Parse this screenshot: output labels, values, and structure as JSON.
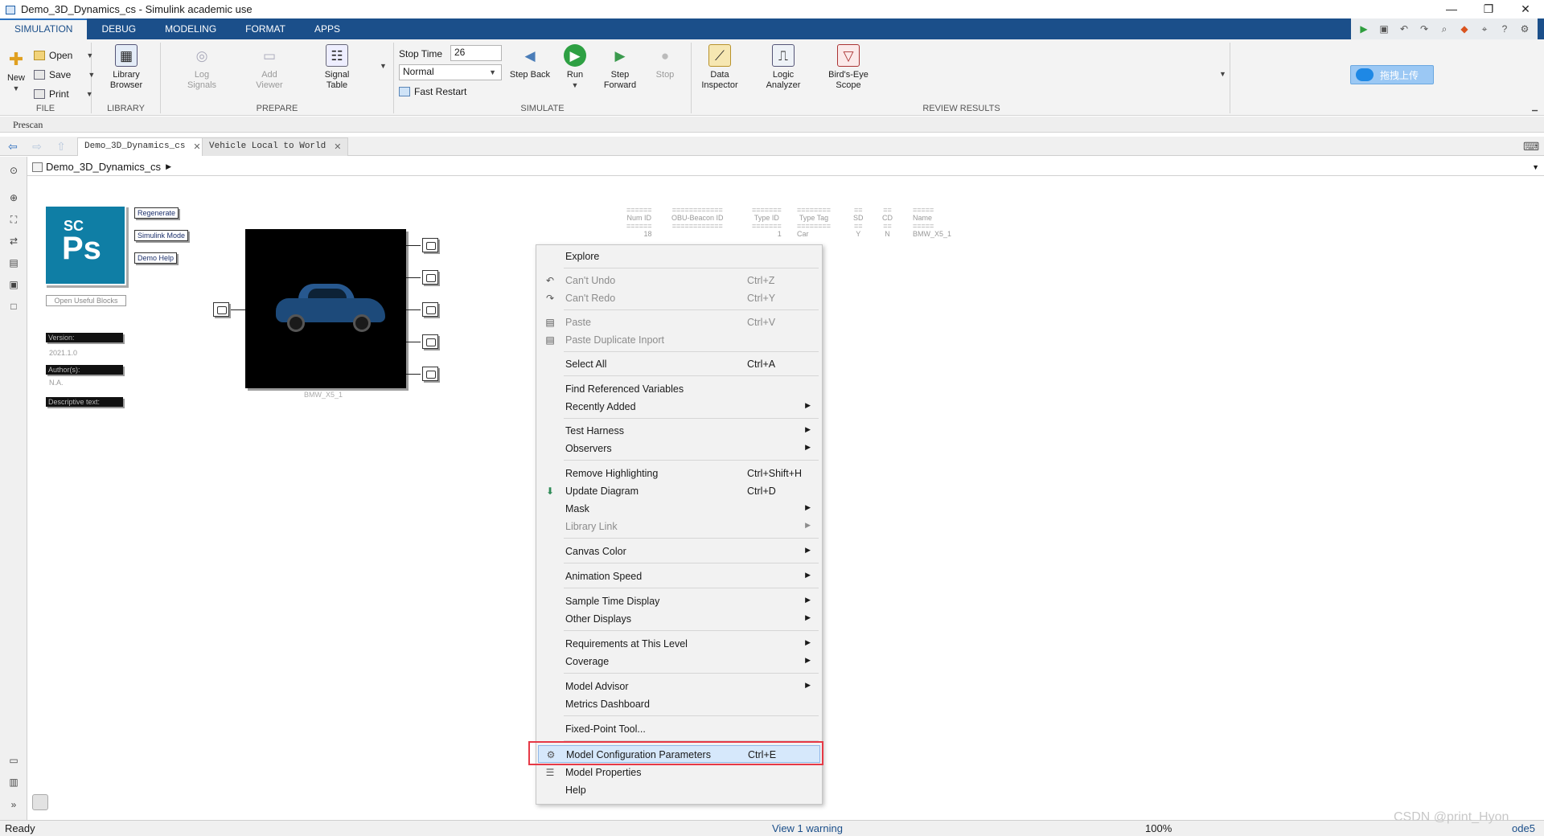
{
  "window": {
    "title": "Demo_3D_Dynamics_cs - Simulink academic use",
    "minimize": "—",
    "restore": "❐",
    "close": "✕"
  },
  "ribbon_tabs": [
    "SIMULATION",
    "DEBUG",
    "MODELING",
    "FORMAT",
    "APPS"
  ],
  "file_group": {
    "label": "FILE",
    "new_label": "New",
    "open_label": "Open",
    "save_label": "Save",
    "print_label": "Print"
  },
  "library_group": {
    "label": "LIBRARY",
    "library_browser": "Library Browser"
  },
  "prepare_group": {
    "label": "PREPARE",
    "log_signals": "Log Signals",
    "add_viewer": "Add Viewer",
    "signal_table": "Signal Table"
  },
  "simulate_group": {
    "label": "SIMULATE",
    "stop_time_label": "Stop Time",
    "stop_time_value": "26",
    "mode_value": "Normal",
    "fast_restart": "Fast Restart",
    "step_back": "Step Back",
    "run": "Run",
    "step_forward": "Step Forward",
    "stop": "Stop"
  },
  "review_group": {
    "label": "REVIEW RESULTS",
    "data_inspector": "Data Inspector",
    "logic_analyzer": "Logic Analyzer",
    "birds_eye_scope": "Bird's-Eye Scope"
  },
  "upload_button": "拖拽上传",
  "prescan_label": "Prescan",
  "doc_tabs": [
    {
      "label": "Demo_3D_Dynamics_cs",
      "close": "✕"
    },
    {
      "label": "Vehicle Local to World",
      "close": "✕"
    }
  ],
  "breadcrumb": "Demo_3D_Dynamics_cs",
  "canvas": {
    "logo_sc": "SC",
    "logo_ps": "Ps",
    "regenerate": "Regenerate",
    "simulink_mode": "Simulink Mode",
    "demo_help": "Demo Help",
    "open_useful_blocks": "Open Useful Blocks",
    "version_label": "Version:",
    "version_value": "2021.1.0",
    "authors_label": "Author(s):",
    "authors_value": "N.A.",
    "descriptive_label": "Descriptive text:",
    "vehicle_caption": "BMW_X5_1",
    "bus_table": [
      {
        "header": "Num ID",
        "value": "18",
        "bar": "======"
      },
      {
        "header": "OBU-Beacon ID",
        "value": "",
        "bar": "============"
      },
      {
        "header": "Type ID",
        "value": "1",
        "bar": "======="
      },
      {
        "header": "Type Tag",
        "value": "Car",
        "bar": "========"
      },
      {
        "header": "SD",
        "value": "Y",
        "bar": "=="
      },
      {
        "header": "CD",
        "value": "N",
        "bar": "=="
      },
      {
        "header": "Name",
        "value": "BMW_X5_1",
        "bar": "====="
      }
    ]
  },
  "context_menu": {
    "items": [
      {
        "label": "Explore",
        "shortcut": "",
        "disabled": false
      },
      {
        "label": "Can't Undo",
        "shortcut": "Ctrl+Z",
        "disabled": true
      },
      {
        "label": "Can't Redo",
        "shortcut": "Ctrl+Y",
        "disabled": true
      },
      {
        "label": "Paste",
        "shortcut": "Ctrl+V",
        "disabled": true
      },
      {
        "label": "Paste Duplicate Inport",
        "shortcut": "",
        "disabled": true
      },
      {
        "label": "Select All",
        "shortcut": "Ctrl+A",
        "disabled": false
      },
      {
        "label": "Find Referenced Variables",
        "shortcut": "",
        "disabled": false
      },
      {
        "label": "Recently Added",
        "shortcut": "",
        "disabled": false
      },
      {
        "label": "Test Harness",
        "shortcut": "",
        "disabled": false
      },
      {
        "label": "Observers",
        "shortcut": "",
        "disabled": false
      },
      {
        "label": "Remove Highlighting",
        "shortcut": "Ctrl+Shift+H",
        "disabled": false
      },
      {
        "label": "Update Diagram",
        "shortcut": "Ctrl+D",
        "disabled": false
      },
      {
        "label": "Mask",
        "shortcut": "",
        "disabled": false
      },
      {
        "label": "Library Link",
        "shortcut": "",
        "disabled": true
      },
      {
        "label": "Canvas Color",
        "shortcut": "",
        "disabled": false
      },
      {
        "label": "Animation Speed",
        "shortcut": "",
        "disabled": false
      },
      {
        "label": "Sample Time Display",
        "shortcut": "",
        "disabled": false
      },
      {
        "label": "Other Displays",
        "shortcut": "",
        "disabled": false
      },
      {
        "label": "Requirements at This Level",
        "shortcut": "",
        "disabled": false
      },
      {
        "label": "Coverage",
        "shortcut": "",
        "disabled": false
      },
      {
        "label": "Model Advisor",
        "shortcut": "",
        "disabled": false
      },
      {
        "label": "Metrics Dashboard",
        "shortcut": "",
        "disabled": false
      },
      {
        "label": "Fixed-Point Tool...",
        "shortcut": "",
        "disabled": false
      },
      {
        "label": "Model Configuration Parameters",
        "shortcut": "Ctrl+E",
        "disabled": false
      },
      {
        "label": "Model Properties",
        "shortcut": "",
        "disabled": false
      },
      {
        "label": "Help",
        "shortcut": "",
        "disabled": false
      }
    ]
  },
  "status_bar": {
    "state": "Ready",
    "warning": "View 1 warning",
    "zoom": "100%",
    "solver": "ode5"
  },
  "watermark": "CSDN @print_Hyon",
  "colors": {
    "ribbon_blue": "#1b4f8a",
    "highlight_red": "#e63946",
    "menu_hover": "#d6e8fb"
  }
}
